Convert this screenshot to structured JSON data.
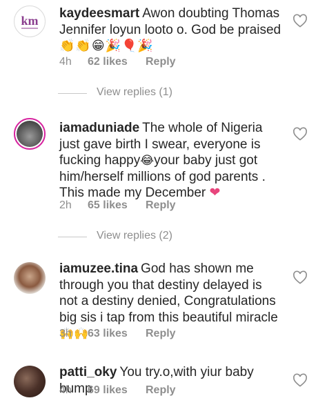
{
  "comments": [
    {
      "username": "kaydeesmart",
      "text": "Awon doubting Thomas Jennifer loyun looto o.  God be praised",
      "emojis": "👏👏😁🎉🎈🎉",
      "time": "4h",
      "likes": "62 likes",
      "reply": "Reply",
      "avatar_initials": "km"
    },
    {
      "username": "iamaduniade",
      "text_before_emoji": "The whole of Nigeria just gave birth I swear, everyone is fucking happy",
      "emoji_inline": "😂",
      "text_after_emoji": "your baby just got him/herself millions of god parents .",
      "text_line2": "This made my December",
      "emoji_end": "❤",
      "time": "2h",
      "likes": "65 likes",
      "reply": "Reply"
    },
    {
      "username": "iamuzee.tina",
      "text": "God has shown me through you that destiny delayed is not a destiny denied, Congratulations big sis i tap from this beautiful miracle",
      "emojis": "🙌🙌",
      "time": "3h",
      "likes": "63 likes",
      "reply": "Reply"
    },
    {
      "username": "patti_oky",
      "text": "You try.o,with yiur baby bump",
      "time": "4h",
      "likes": "69 likes",
      "reply": "Reply"
    }
  ],
  "view_replies": [
    {
      "label": "View replies (1)"
    },
    {
      "label": "View replies (2)"
    }
  ],
  "colors": {
    "primary_text": "#262626",
    "secondary_text": "#8e8e8e",
    "heart_emoji": "#e8457c",
    "story_ring": "#d6249f"
  },
  "icons": [
    "heart-outline-icon",
    "avatar"
  ]
}
